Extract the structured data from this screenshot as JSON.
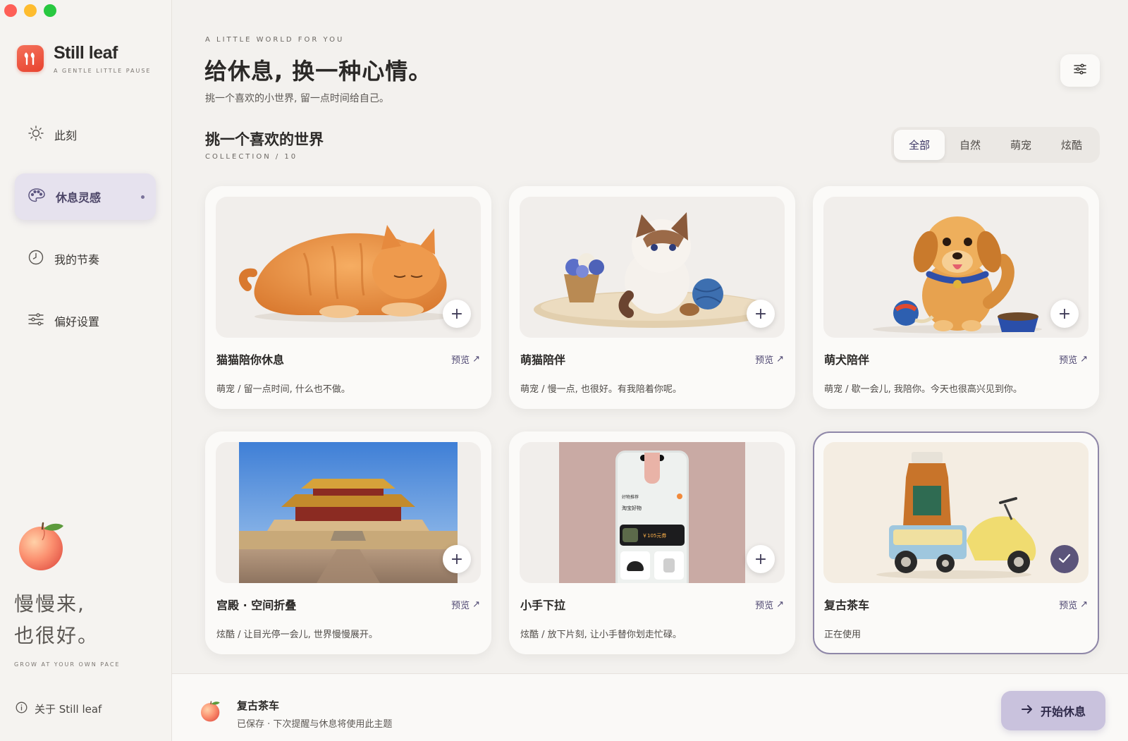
{
  "app": {
    "name": "Still leaf",
    "tagline": "A GENTLE LITTLE PAUSE"
  },
  "sidebar": {
    "items": [
      {
        "label": "此刻",
        "icon": "sun-icon"
      },
      {
        "label": "休息灵感",
        "icon": "palette-icon",
        "active": true
      },
      {
        "label": "我的节奏",
        "icon": "clock-icon"
      },
      {
        "label": "偏好设置",
        "icon": "sliders-icon"
      }
    ],
    "slogan_line1": "慢慢来,",
    "slogan_line2": "也很好。",
    "slogan_sub": "GROW AT YOUR OWN PACE",
    "about": "关于 Still leaf"
  },
  "header": {
    "eyebrow": "A LITTLE WORLD FOR YOU",
    "title": "给休息, 换一种心情。",
    "subtitle": "挑一个喜欢的小世界, 留一点时间给自己。"
  },
  "section": {
    "title": "挑一个喜欢的世界",
    "subtitle": "COLLECTION / 10"
  },
  "filters": {
    "tabs": [
      "全部",
      "自然",
      "萌宠",
      "炫酷"
    ],
    "active_index": 0
  },
  "cards": [
    {
      "title": "猫猫陪你休息",
      "preview": "预览",
      "desc": "萌宠 / 留一点时间, 什么也不做。",
      "art": "orange-cat"
    },
    {
      "title": "萌猫陪伴",
      "preview": "预览",
      "desc": "萌宠 / 慢一点, 也很好。有我陪着你呢。",
      "art": "ragdoll-cat"
    },
    {
      "title": "萌犬陪伴",
      "preview": "预览",
      "desc": "萌宠 / 歇一会儿, 我陪你。今天也很高兴见到你。",
      "art": "puppy"
    },
    {
      "title": "宫殿 · 空间折叠",
      "preview": "预览",
      "desc": "炫酷 / 让目光停一会儿, 世界慢慢展开。",
      "art": "palace"
    },
    {
      "title": "小手下拉",
      "preview": "预览",
      "desc": "炫酷 / 放下片刻, 让小手替你划走忙碌。",
      "art": "phone",
      "phone_text": {
        "header": "好物推荐",
        "shop": "淘宝好物",
        "promo": "￥105元券"
      }
    },
    {
      "title": "复古茶车",
      "preview": "预览",
      "desc": "正在使用",
      "art": "tea-cart",
      "selected": true
    }
  ],
  "bottom": {
    "title": "复古茶车",
    "subtitle": "已保存 · 下次提醒与休息将使用此主题",
    "start_label": "开始休息"
  },
  "colors": {
    "accent": "#5b547a",
    "accent_light": "#c9c2dd",
    "logo_red": "#e8432f"
  }
}
